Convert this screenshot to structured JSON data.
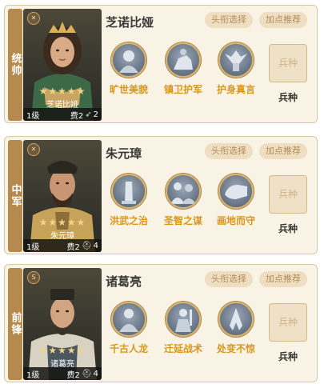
{
  "colors": {
    "card_bg": "#f9f3e6",
    "role_strip": "#b68a4e",
    "skill_text": "#d9961a",
    "button_bg": "#efdfc2",
    "button_text": "#b38a5a",
    "star": "#f0d487"
  },
  "buttons": {
    "title_select": "头衔选择",
    "points_recommend": "加点推荐"
  },
  "generals": [
    {
      "role": "统帅",
      "name": "芝诺比娅",
      "portrait_label": "芝诺比娅",
      "stars": "★★★★★",
      "level": "1级",
      "cost": "费2",
      "cost_icon": "feather-icon",
      "cost_extra": "2",
      "skills": [
        {
          "label": "旷世美貌",
          "icon": "statue-portrait-icon"
        },
        {
          "label": "镇卫护军",
          "icon": "cavalry-icon"
        },
        {
          "label": "护身真言",
          "icon": "wings-icon"
        }
      ],
      "slot_text": "兵种",
      "slot_label": "兵种"
    },
    {
      "role": "中军",
      "name": "朱元璋",
      "portrait_label": "朱元璋",
      "stars": "★★★★★",
      "level": "1级",
      "cost": "费2",
      "cost_icon": "helmet-icon",
      "cost_extra": "4",
      "skills": [
        {
          "label": "洪武之治",
          "icon": "monument-icon"
        },
        {
          "label": "圣智之谋",
          "icon": "advisors-icon"
        },
        {
          "label": "画地而守",
          "icon": "gauntlet-icon"
        }
      ],
      "slot_text": "兵种",
      "slot_label": "兵种"
    },
    {
      "role": "前锋",
      "name": "诸葛亮",
      "portrait_label": "诸葛亮",
      "stars": "★★★★★",
      "level": "1级",
      "cost": "费2",
      "cost_icon": "helmet-icon",
      "cost_extra": "4",
      "skills": [
        {
          "label": "千古人龙",
          "icon": "scholar-icon"
        },
        {
          "label": "迁延战术",
          "icon": "warrior-icon"
        },
        {
          "label": "处变不惊",
          "icon": "praying-hands-icon"
        }
      ],
      "slot_text": "兵种",
      "slot_label": "兵种"
    }
  ]
}
